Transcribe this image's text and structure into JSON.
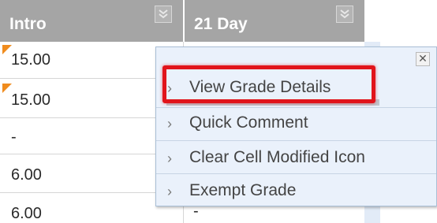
{
  "columns": [
    {
      "title": "Intro"
    },
    {
      "title": "21 Day"
    }
  ],
  "rows": [
    {
      "value": "15.00",
      "modified": true
    },
    {
      "value": "15.00",
      "modified": true
    },
    {
      "value": "-",
      "modified": false
    },
    {
      "value": "6.00",
      "modified": false
    },
    {
      "value": "6.00",
      "modified": false
    }
  ],
  "right_column_last_value": "-",
  "menu": {
    "close_label": "✕",
    "items": [
      {
        "label": "View Grade Details"
      },
      {
        "label": "Quick Comment"
      },
      {
        "label": "Clear Cell Modified Icon"
      },
      {
        "label": "Exempt Grade"
      }
    ],
    "arrow": "›"
  },
  "colors": {
    "header_bg": "#a5a5a5",
    "menu_bg": "#eaf1fb",
    "highlight": "#e1141b",
    "modified_flag": "#f08c1e"
  }
}
